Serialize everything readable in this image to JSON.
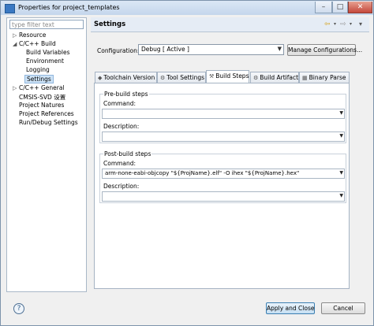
{
  "window": {
    "title": "Properties for project_templates"
  },
  "sidebar": {
    "filter_placeholder": "type filter text",
    "items": [
      {
        "label": "Resource",
        "toggle": "▷"
      },
      {
        "label": "C/C++ Build",
        "toggle": "◢"
      },
      {
        "label": "Build Variables",
        "toggle": ""
      },
      {
        "label": "Environment",
        "toggle": ""
      },
      {
        "label": "Logging",
        "toggle": ""
      },
      {
        "label": "Settings",
        "toggle": ""
      },
      {
        "label": "C/C++ General",
        "toggle": "▷"
      },
      {
        "label": "CMSIS-SVD 设置",
        "toggle": ""
      },
      {
        "label": "Project Natures",
        "toggle": ""
      },
      {
        "label": "Project References",
        "toggle": ""
      },
      {
        "label": "Run/Debug Settings",
        "toggle": ""
      }
    ]
  },
  "header": {
    "title": "Settings",
    "nav": {
      "back_icon": "⇦",
      "forward_icon": "⇨",
      "menu_icon": "▾"
    }
  },
  "configuration": {
    "label": "Configuration:",
    "value": "Debug  [ Active ]",
    "manage_button": "Manage Configurations..."
  },
  "tabs": [
    {
      "label": "Toolchain  Version",
      "icon": "◆"
    },
    {
      "label": "Tool Settings",
      "icon": "⚙"
    },
    {
      "label": "Build Steps",
      "icon": "⚒"
    },
    {
      "label": "Build Artifact",
      "icon": "⚙"
    },
    {
      "label": "Binary Parse",
      "icon": "▦"
    }
  ],
  "prebuild": {
    "title": "Pre-build steps",
    "command_label": "Command:",
    "command_value": "",
    "description_label": "Description:",
    "description_value": ""
  },
  "postbuild": {
    "title": "Post-build steps",
    "command_label": "Command:",
    "command_value": "arm-none-eabi-objcopy \"${ProjName}.elf\" -O ihex \"${ProjName}.hex\"",
    "description_label": "Description:",
    "description_value": ""
  },
  "footer": {
    "help_icon": "?",
    "apply_close": "Apply and Close",
    "cancel": "Cancel"
  }
}
